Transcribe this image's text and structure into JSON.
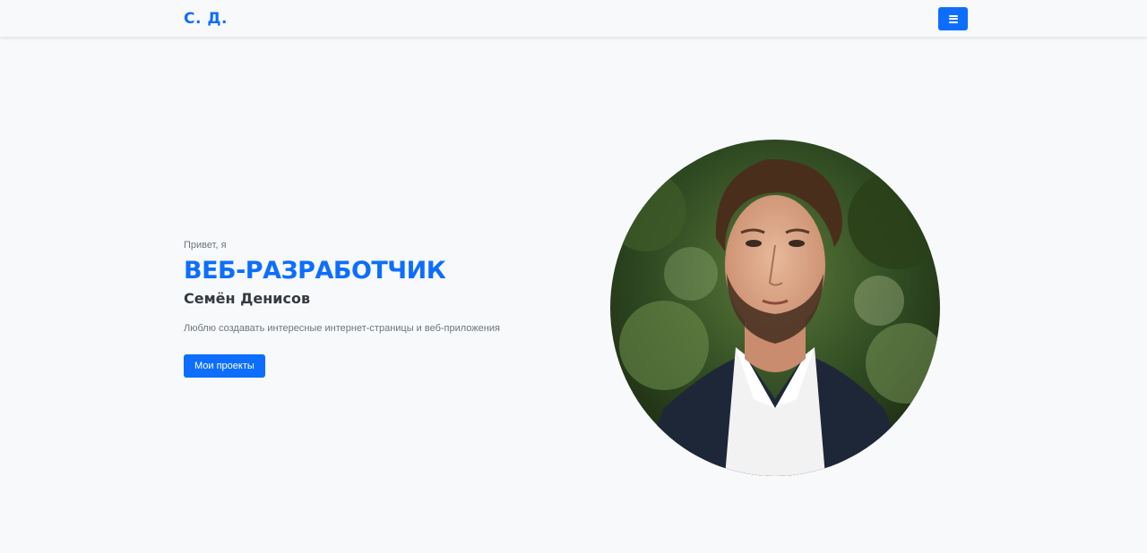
{
  "navbar": {
    "brand": "С. Д.",
    "menu_icon": "hamburger-icon"
  },
  "hero": {
    "greeting": "Привет, я",
    "role": "ВЕБ-РАЗРАБОТЧИК",
    "name": "Семён Денисов",
    "tagline": "Люблю создавать интересные интернет-страницы и веб-приложения",
    "cta_label": "Мои проекты"
  },
  "colors": {
    "accent": "#0d6efd",
    "background": "#f8f9fa",
    "muted": "#6c757d"
  }
}
